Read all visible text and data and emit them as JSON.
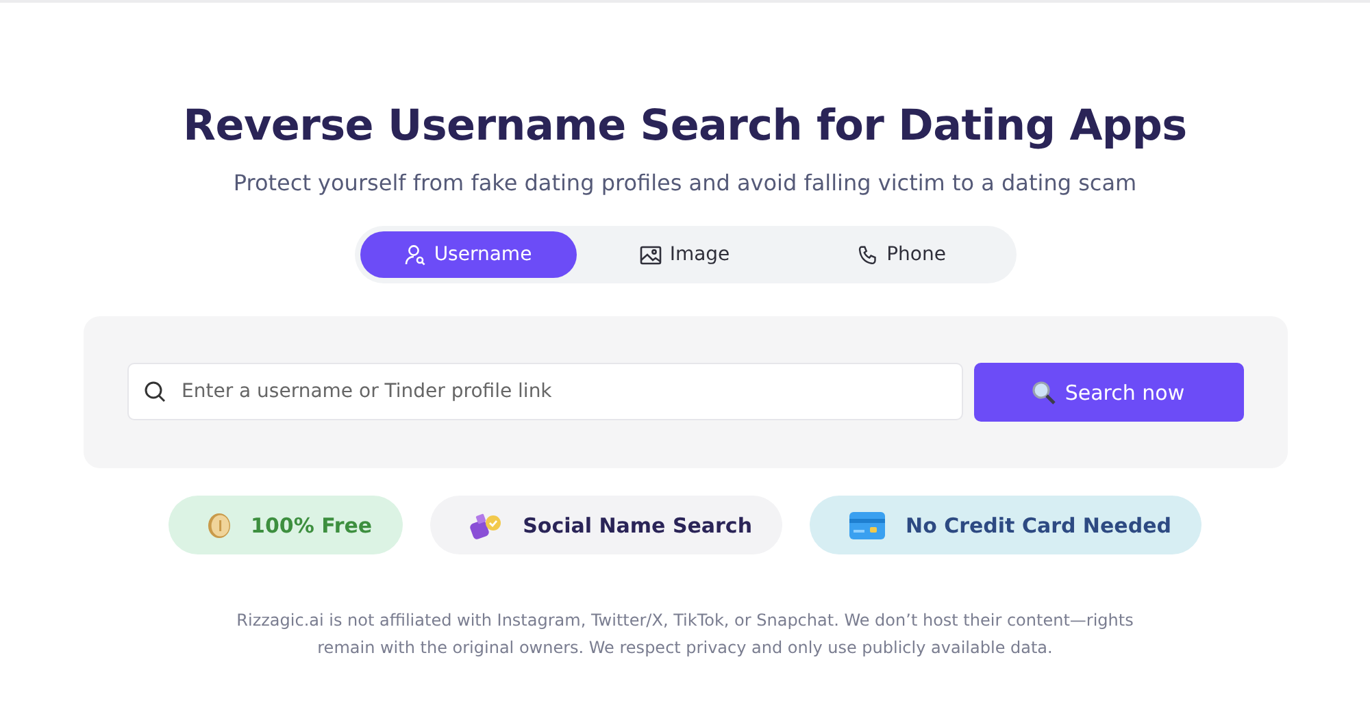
{
  "title": "Reverse Username Search for Dating Apps",
  "subtitle": "Protect yourself from fake dating profiles and avoid falling victim to a dating scam",
  "tabs": [
    {
      "label": "Username",
      "kind": "user",
      "selected": true
    },
    {
      "label": "Image",
      "kind": "image",
      "selected": false
    },
    {
      "label": "Phone",
      "kind": "phone",
      "selected": false
    }
  ],
  "search": {
    "placeholder": "Enter a username or Tinder profile link",
    "button": "Search now"
  },
  "badges": [
    {
      "label": "100% Free",
      "kind": "coin",
      "color": "#dcf3e4"
    },
    {
      "label": "Social Name Search",
      "kind": "bottle",
      "color": "#f3f3f5"
    },
    {
      "label": "No Credit Card Needed",
      "kind": "card",
      "color": "#d7eef3"
    }
  ],
  "disclaimer": "Rizzagic.ai is not affiliated with Instagram, Twitter/X, TikTok, or Snapchat. We don’t host their content—rights remain with the original owners. We respect privacy and only use publicly available data."
}
